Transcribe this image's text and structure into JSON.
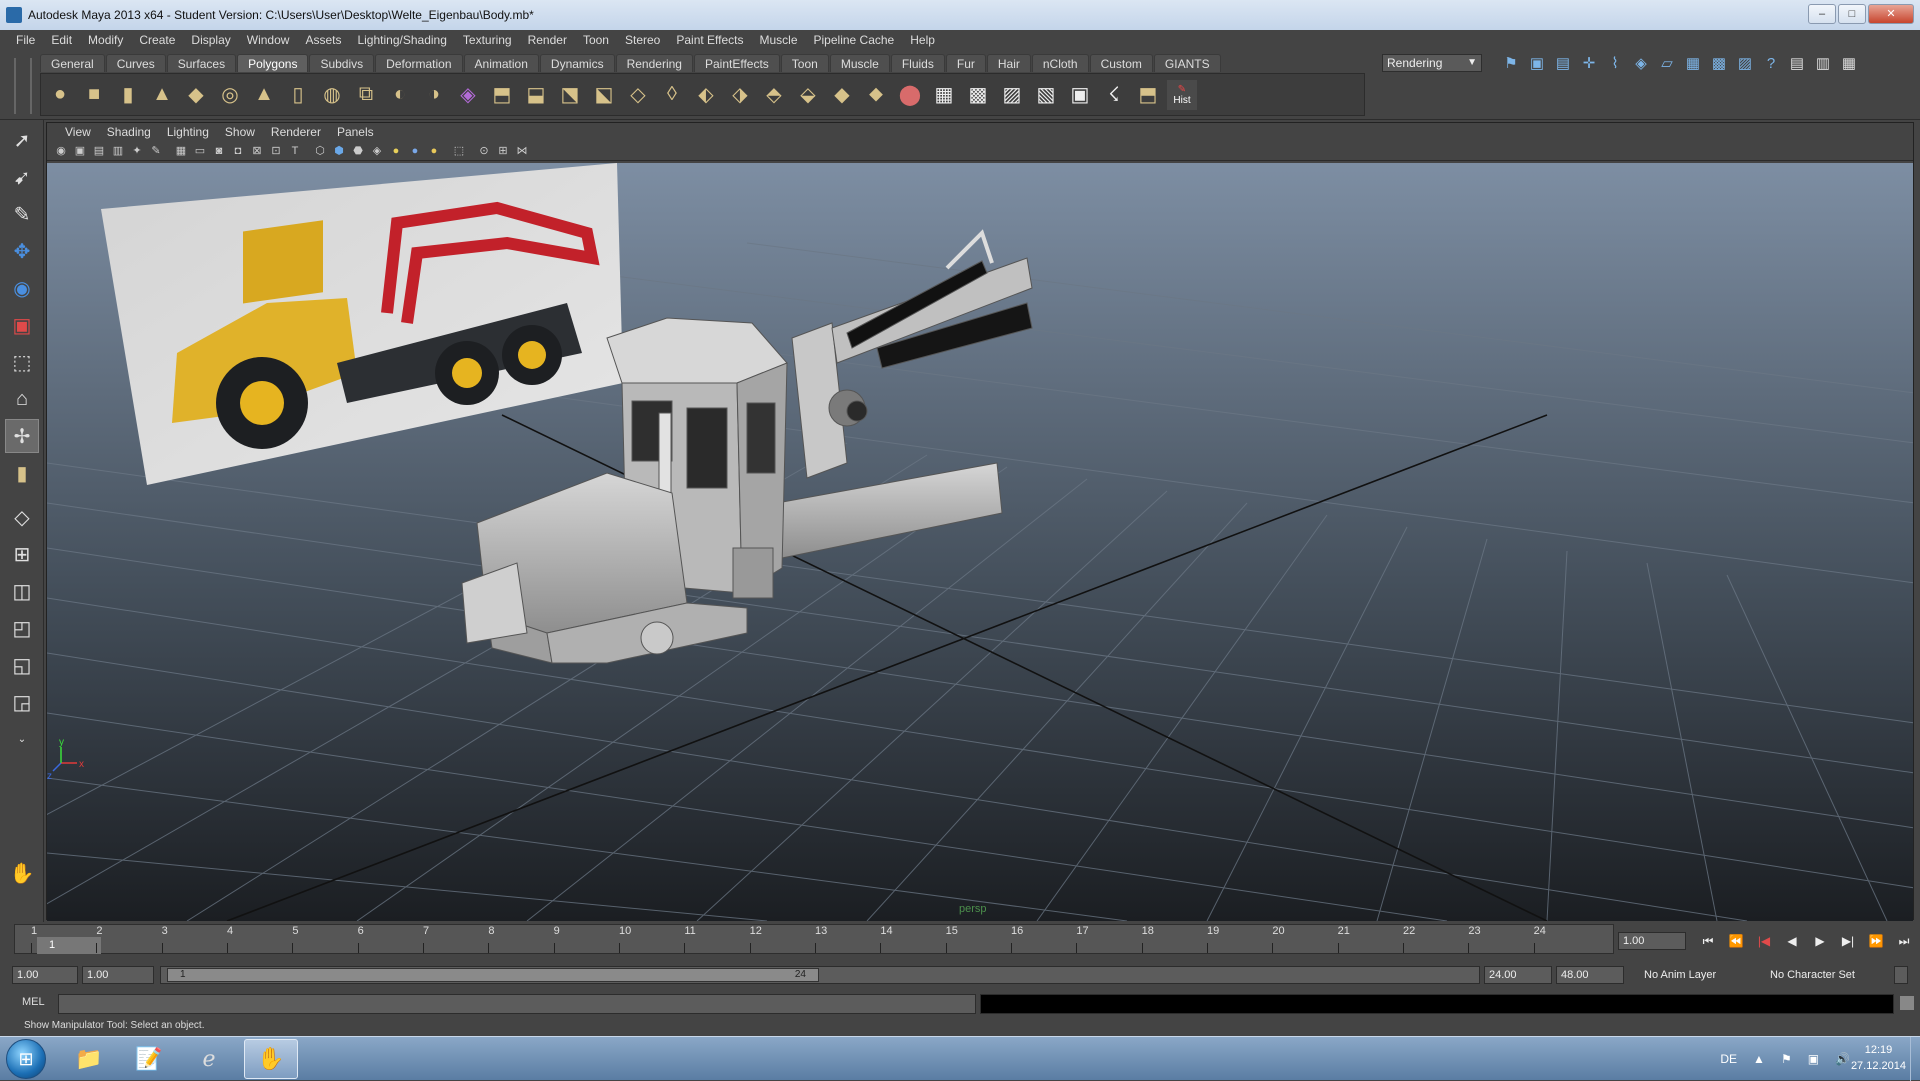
{
  "window": {
    "title": "Autodesk Maya 2013 x64 - Student Version: C:\\Users\\User\\Desktop\\Welte_Eigenbau\\Body.mb*",
    "buttons": {
      "minimize": "–",
      "maximize": "□",
      "close": "✕"
    }
  },
  "menubar": [
    "File",
    "Edit",
    "Modify",
    "Create",
    "Display",
    "Window",
    "Assets",
    "Lighting/Shading",
    "Texturing",
    "Render",
    "Toon",
    "Stereo",
    "Paint Effects",
    "Muscle",
    "Pipeline Cache",
    "Help"
  ],
  "shelf": {
    "tabs": [
      "General",
      "Curves",
      "Surfaces",
      "Polygons",
      "Subdivs",
      "Deformation",
      "Animation",
      "Dynamics",
      "Rendering",
      "PaintEffects",
      "Toon",
      "Muscle",
      "Fluids",
      "Fur",
      "Hair",
      "nCloth",
      "Custom",
      "GIANTS"
    ],
    "active_tab": "Polygons",
    "hist_label": "Hist"
  },
  "mode_menu": {
    "value": "Rendering"
  },
  "panel": {
    "menus": [
      "View",
      "Shading",
      "Lighting",
      "Show",
      "Renderer",
      "Panels"
    ],
    "camera_label": "persp",
    "axis_labels": {
      "x": "x",
      "y": "y",
      "z": "z"
    }
  },
  "timeslider": {
    "ticks": [
      "1",
      "2",
      "3",
      "4",
      "5",
      "6",
      "7",
      "8",
      "9",
      "10",
      "11",
      "12",
      "13",
      "14",
      "15",
      "16",
      "17",
      "18",
      "19",
      "20",
      "21",
      "22",
      "23",
      "24"
    ],
    "current_frame": "1",
    "current_time_field": "1.00"
  },
  "rangeslider": {
    "anim_start": "1.00",
    "playback_start": "1.00",
    "range_start_label": "1",
    "range_end_label": "24",
    "playback_end": "24.00",
    "anim_end": "48.00",
    "anim_layer": "No Anim Layer",
    "character_set": "No Character Set"
  },
  "cmdline": {
    "label": "MEL"
  },
  "helpline": {
    "text": "Show Manipulator Tool: Select an object."
  },
  "taskbar": {
    "language": "DE",
    "time": "12:19",
    "date": "27.12.2014"
  }
}
